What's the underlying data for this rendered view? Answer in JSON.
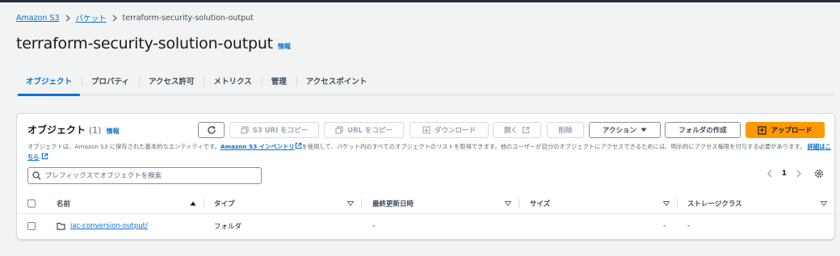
{
  "breadcrumb": {
    "items": [
      "Amazon S3",
      "バケット"
    ],
    "current": "terraform-security-solution-output"
  },
  "title": "terraform-security-solution-output",
  "title_info": "情報",
  "tabs": [
    "オブジェクト",
    "プロパティ",
    "アクセス許可",
    "メトリクス",
    "管理",
    "アクセスポイント"
  ],
  "panel": {
    "title": "オブジェクト",
    "count": "(1)",
    "info": "情報",
    "desc_1": "オブジェクトは、Amazon S3 に保存された基本的なエンティティです。",
    "desc_link_1": "Amazon S3 インベントリ",
    "desc_2": "を使用して、バケット内のすべてのオブジェクトのリストを取得できます。他のユーザーが自分のオブジェクトにアクセスできるためには、明示的にアクセス権限を付与する必要があります。",
    "desc_link_2": "詳細はこちら"
  },
  "toolbar": {
    "copy_s3_uri": "S3 URI をコピー",
    "copy_url": "URL をコピー",
    "download": "ダウンロード",
    "open": "開く",
    "delete": "削除",
    "actions": "アクション",
    "create_folder": "フォルダの作成",
    "upload": "アップロード"
  },
  "search": {
    "placeholder": "プレフィックスでオブジェクトを検索"
  },
  "pagination": {
    "page": "1"
  },
  "table": {
    "headers": [
      "名前",
      "タイプ",
      "最終更新日時",
      "サイズ",
      "ストレージクラス"
    ],
    "rows": [
      {
        "name": "iac-conversion-output/",
        "type": "フォルダ",
        "modified": "-",
        "size": "-",
        "storage": "-"
      }
    ]
  },
  "colors": {
    "link": "#0972d3",
    "primary": "#ff9900",
    "header": "#232f3e"
  }
}
